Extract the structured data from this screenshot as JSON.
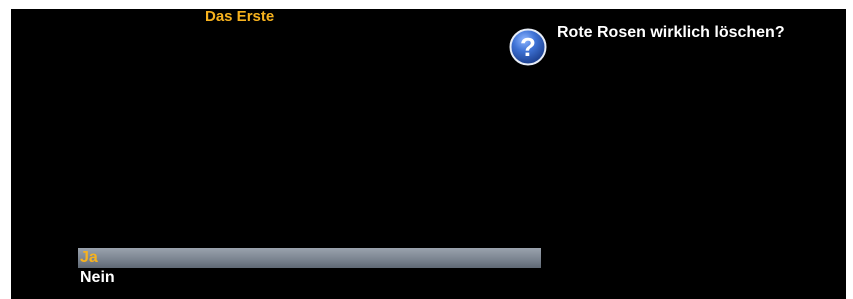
{
  "channel": {
    "name": "Das Erste"
  },
  "dialog": {
    "icon": "question-icon",
    "question": "Rote Rosen wirklich löschen?",
    "options": [
      {
        "label": "Ja",
        "selected": true
      },
      {
        "label": "Nein",
        "selected": false
      }
    ]
  },
  "colors": {
    "background": "#000000",
    "highlight_text": "#f7b21e",
    "text": "#ffffff",
    "selection_bar": "#7c8591",
    "icon_blue": "#2f63c4"
  }
}
